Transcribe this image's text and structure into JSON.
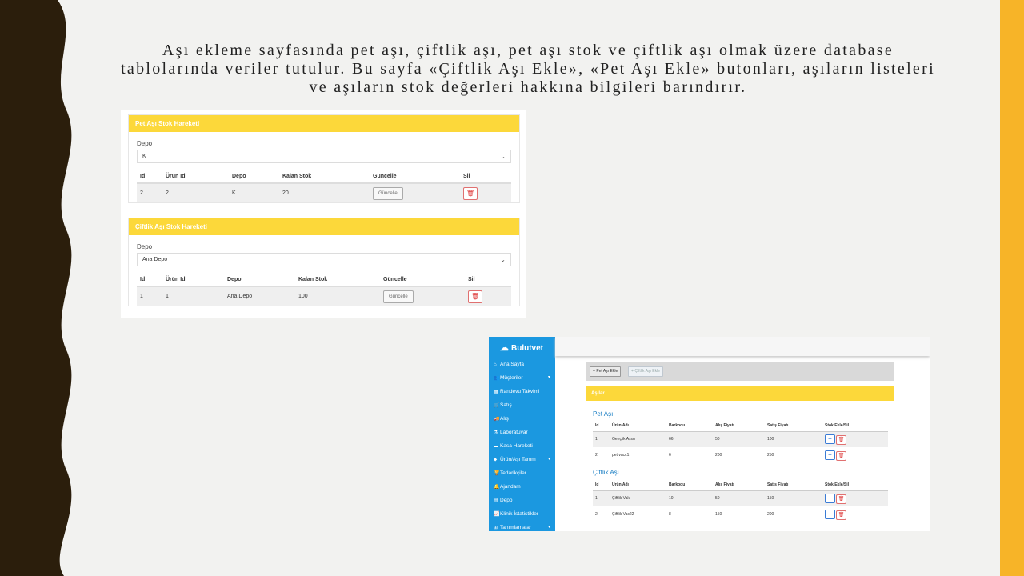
{
  "caption": "Aşı ekleme sayfasında pet aşı, çiftlik aşı, pet aşı stok ve çiftlik aşı olmak üzere database tablolarında veriler tutulur. Bu sayfa «Çiftlik Aşı Ekle», «Pet Aşı Ekle» butonları, aşıların listeleri ve aşıların stok değerleri hakkına bilgileri barındırır.",
  "colors": {
    "dark_brown": "#2b1e0c",
    "accent_yellow": "#f7b428",
    "card_header": "#fcd83a",
    "sidebar_blue": "#1b98e0"
  },
  "pet_stock": {
    "title": "Pet Aşı Stok Hareketi",
    "depo_label": "Depo",
    "depo_value": "K",
    "columns": [
      "Id",
      "Ürün Id",
      "Depo",
      "Kalan Stok",
      "Güncelle",
      "Sil"
    ],
    "rows": [
      {
        "id": "2",
        "urun_id": "2",
        "depo": "K",
        "kalan": "20",
        "guncelle": "Güncelle"
      }
    ]
  },
  "farm_stock": {
    "title": "Çiftlik Aşı Stok Hareketi",
    "depo_label": "Depo",
    "depo_value": "Ana Depo",
    "columns": [
      "Id",
      "Ürün Id",
      "Depo",
      "Kalan Stok",
      "Güncelle",
      "Sil"
    ],
    "rows": [
      {
        "id": "1",
        "urun_id": "1",
        "depo": "Ana Depo",
        "kalan": "100",
        "guncelle": "Güncelle"
      }
    ]
  },
  "app": {
    "brand": "Bulutvet",
    "nav": [
      {
        "label": "Ana Sayfa",
        "icon": "home-icon"
      },
      {
        "label": "Müşteriler",
        "icon": "users-icon",
        "caret": true
      },
      {
        "label": "Randevu Takvimi",
        "icon": "calendar-icon"
      },
      {
        "label": "Satış",
        "icon": "cart-icon"
      },
      {
        "label": "Alış",
        "icon": "truck-icon"
      },
      {
        "label": "Laboratuvar",
        "icon": "flask-icon"
      },
      {
        "label": "Kasa Hareketi",
        "icon": "money-icon"
      },
      {
        "label": "Ürün/Aşı Tanım",
        "icon": "tags-icon",
        "caret": true
      },
      {
        "label": "Tedarikçiler",
        "icon": "trophy-icon"
      },
      {
        "label": "Ajandam",
        "icon": "bell-icon"
      },
      {
        "label": "Depo",
        "icon": "warehouse-icon"
      },
      {
        "label": "Klinik İstatistikler",
        "icon": "chart-icon"
      },
      {
        "label": "Tanımlamalar",
        "icon": "plus-square-icon",
        "caret": true
      }
    ],
    "toolbar": {
      "pet_add": "Pet Aşı Ekle",
      "farm_add": "Çiftlik Aşı Ekle"
    },
    "card_title": "Aşılar",
    "pet_section": {
      "title": "Pet Aşı",
      "columns": [
        "Id",
        "Ürün Adı",
        "Barkodu",
        "Alış Fiyatı",
        "Satış Fiyatı",
        "Stok Ekle/Sil"
      ],
      "rows": [
        {
          "id": "1",
          "name": "Gençlik Aşısı",
          "barcode": "66",
          "buy": "50",
          "sell": "100"
        },
        {
          "id": "2",
          "name": "pet vacc1",
          "barcode": "6",
          "buy": "200",
          "sell": "250"
        }
      ]
    },
    "farm_section": {
      "title": "Çiftlik Aşı",
      "columns": [
        "Id",
        "Ürün Adı",
        "Barkodu",
        "Alış Fiyatı",
        "Satış Fiyatı",
        "Stok Ekle/Sil"
      ],
      "rows": [
        {
          "id": "1",
          "name": "Çiftlik Vak",
          "barcode": "10",
          "buy": "50",
          "sell": "150"
        },
        {
          "id": "2",
          "name": "Çiftlik Vac22",
          "barcode": "8",
          "buy": "150",
          "sell": "200"
        }
      ]
    }
  }
}
